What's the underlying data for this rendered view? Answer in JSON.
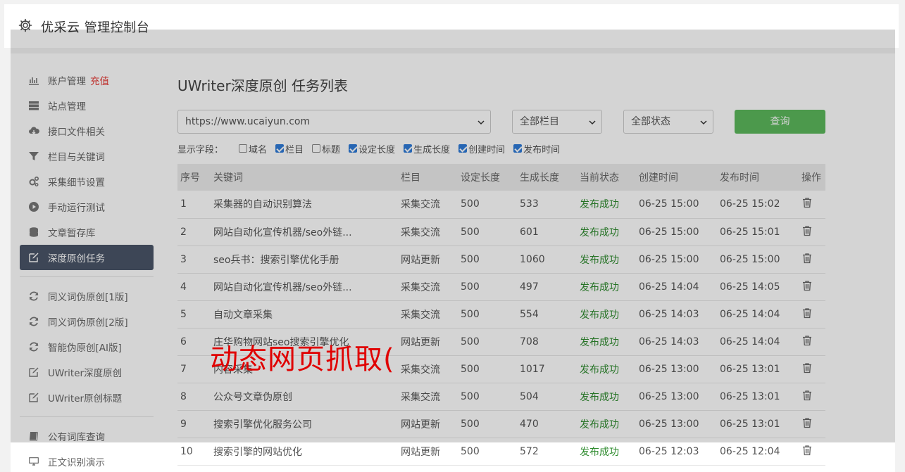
{
  "header": {
    "title": "优采云 管理控制台"
  },
  "sidebar": {
    "group1": [
      {
        "label": "账户管理",
        "badge": "充值",
        "icon": "bar-chart-icon"
      },
      {
        "label": "站点管理",
        "icon": "server-icon"
      },
      {
        "label": "接口文件相关",
        "icon": "cloud-download-icon"
      },
      {
        "label": "栏目与关键词",
        "icon": "filter-icon"
      },
      {
        "label": "采集细节设置",
        "icon": "gears-icon"
      },
      {
        "label": "手动运行测试",
        "icon": "play-circle-icon"
      },
      {
        "label": "文章暂存库",
        "icon": "database-icon"
      },
      {
        "label": "深度原创任务",
        "icon": "edit-icon",
        "active": true
      }
    ],
    "group2": [
      {
        "label": "同义词伪原创[1版]",
        "icon": "refresh-icon"
      },
      {
        "label": "同义词伪原创[2版]",
        "icon": "refresh-icon"
      },
      {
        "label": "智能伪原创[AI版]",
        "icon": "refresh-icon"
      },
      {
        "label": "UWriter深度原创",
        "icon": "edit-icon"
      },
      {
        "label": "UWriter原创标题",
        "icon": "edit-icon"
      }
    ],
    "group3": [
      {
        "label": "公有词库查询",
        "icon": "book-icon"
      },
      {
        "label": "正文识别演示",
        "icon": "monitor-icon"
      }
    ]
  },
  "main": {
    "title": "UWriter深度原创 任务列表",
    "site_select": "https://www.ucaiyun.com",
    "column_select": "全部栏目",
    "status_select": "全部状态",
    "query_button": "查询",
    "fields_label": "显示字段：",
    "fields": [
      {
        "label": "域名",
        "checked": false
      },
      {
        "label": "栏目",
        "checked": true
      },
      {
        "label": "标题",
        "checked": false
      },
      {
        "label": "设定长度",
        "checked": true
      },
      {
        "label": "生成长度",
        "checked": true
      },
      {
        "label": "创建时间",
        "checked": true
      },
      {
        "label": "发布时间",
        "checked": true
      }
    ],
    "table": {
      "headers": [
        "序号",
        "关键词",
        "栏目",
        "设定长度",
        "生成长度",
        "当前状态",
        "创建时间",
        "发布时间",
        "操作"
      ],
      "rows": [
        [
          "1",
          "采集器的自动识别算法",
          "采集交流",
          "500",
          "533",
          "发布成功",
          "06-25 15:00",
          "06-25 15:02"
        ],
        [
          "2",
          "网站自动化宣传机器/seo外链...",
          "采集交流",
          "500",
          "601",
          "发布成功",
          "06-25 15:00",
          "06-25 15:01"
        ],
        [
          "3",
          "seo兵书：搜索引擎优化手册",
          "网站更新",
          "500",
          "1060",
          "发布成功",
          "06-25 15:00",
          "06-25 15:00"
        ],
        [
          "4",
          "网站自动化宣传机器/seo外链...",
          "采集交流",
          "500",
          "497",
          "发布成功",
          "06-25 14:04",
          "06-25 14:05"
        ],
        [
          "5",
          "自动文章采集",
          "采集交流",
          "500",
          "554",
          "发布成功",
          "06-25 14:03",
          "06-25 14:04"
        ],
        [
          "6",
          "庄华购物网站seo搜索引擎优化",
          "网站更新",
          "500",
          "708",
          "发布成功",
          "06-25 14:03",
          "06-25 14:04"
        ],
        [
          "7",
          "内容采集",
          "采集交流",
          "500",
          "1017",
          "发布成功",
          "06-25 13:00",
          "06-25 13:01"
        ],
        [
          "8",
          "公众号文章伪原创",
          "采集交流",
          "500",
          "504",
          "发布成功",
          "06-25 13:00",
          "06-25 13:01"
        ],
        [
          "9",
          "搜索引擎优化服务公司",
          "网站更新",
          "500",
          "470",
          "发布成功",
          "06-25 13:00",
          "06-25 13:01"
        ],
        [
          "10",
          "搜索引擎的网站优化",
          "网站更新",
          "500",
          "572",
          "发布成功",
          "06-25 12:03",
          "06-25 12:04"
        ]
      ]
    }
  },
  "watermark": "动态网页抓取(",
  "colors": {
    "active_nav": "#4a5568",
    "query_button": "#5cb85c",
    "status_ok": "#2e8b2e",
    "recharge": "#e53935",
    "watermark": "#e00000"
  }
}
